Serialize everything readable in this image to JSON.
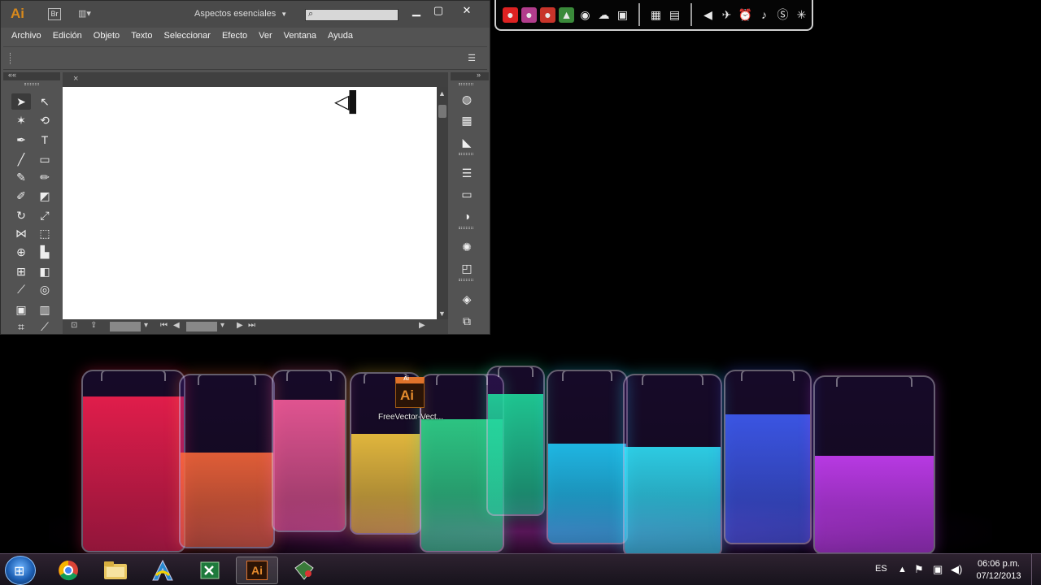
{
  "illustrator": {
    "logo": "Ai",
    "bridge_label": "Br",
    "arrange_icon": "arrange-documents-icon",
    "workspace": "Aspectos esenciales",
    "search_placeholder": "",
    "window_controls": [
      "minimize-icon",
      "maximize-icon",
      "close-icon"
    ],
    "menu": [
      "Archivo",
      "Edición",
      "Objeto",
      "Texto",
      "Seleccionar",
      "Efecto",
      "Ver",
      "Ventana",
      "Ayuda"
    ],
    "tools": [
      "selection-tool-icon",
      "direct-selection-tool-icon",
      "magic-wand-tool-icon",
      "lasso-tool-icon",
      "pen-tool-icon",
      "type-tool-icon",
      "line-segment-tool-icon",
      "rectangle-tool-icon",
      "paintbrush-tool-icon",
      "pencil-tool-icon",
      "blob-brush-tool-icon",
      "eraser-tool-icon",
      "rotate-tool-icon",
      "scale-tool-icon",
      "width-tool-icon",
      "free-transform-tool-icon",
      "shape-builder-tool-icon",
      "perspective-grid-tool-icon",
      "mesh-tool-icon",
      "gradient-tool-icon",
      "eyedropper-tool-icon",
      "blend-tool-icon",
      "symbol-sprayer-tool-icon",
      "column-graph-tool-icon",
      "artboard-tool-icon",
      "slice-tool-icon"
    ],
    "dock_icons": [
      "color-guide-icon",
      "swatches-icon",
      "brushes-icon",
      "stroke-icon",
      "gradient-icon",
      "transparency-icon",
      "appearance-icon",
      "graphic-styles-icon",
      "layers-icon",
      "artboards-icon"
    ]
  },
  "gadget_bar": {
    "group1": [
      "angry-birds-red-icon",
      "angry-birds-space-icon",
      "angry-birds-rio-icon",
      "game-icon",
      "eye-icon",
      "cloud-icon",
      "screen-icon"
    ],
    "group2": [
      "windows-icon",
      "taskmanager-icon"
    ],
    "group3": [
      "volume-icon",
      "brightness-icon",
      "alarm-icon",
      "music-icon",
      "skype-icon",
      "effects-icon"
    ]
  },
  "desktop_file": {
    "badge": "Ai",
    "label": "Ai",
    "name": "FreeVector-Vect..."
  },
  "taskbar": {
    "apps": [
      "chrome-icon",
      "file-explorer-icon",
      "arch-app-icon",
      "excel-icon",
      "illustrator-icon",
      "utility-icon"
    ],
    "active_app": "illustrator-icon",
    "illustrator_label": "Ai",
    "language": "ES",
    "time": "06:06 p.m.",
    "date": "07/12/2013"
  },
  "colors": {
    "illustrator_orange": "#e0732b",
    "panel_gray": "#535353",
    "jar_colors": [
      "#ff2050",
      "#ff6a3a",
      "#ff5fa0",
      "#ffd040",
      "#30e090",
      "#20e0a0",
      "#20d0ff",
      "#30e8ff",
      "#4060ff",
      "#d040ff"
    ]
  }
}
